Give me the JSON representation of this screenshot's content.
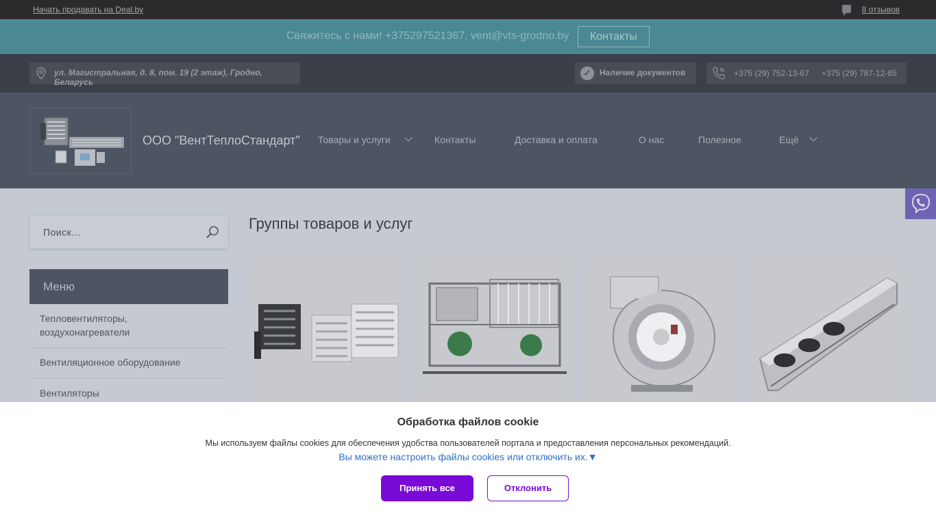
{
  "topbar": {
    "sell_link": "Начать продавать на Deal.by",
    "reviews_link": "8 отзывов"
  },
  "contact_bar": {
    "text": "Свяжитесь с нами! +375297521367, vent@vts-grodno.by",
    "button": "Контакты"
  },
  "info_bar": {
    "address": "ул. Магистральная, д. 8, пом. 19 (2 этаж), Гродно, Беларусь",
    "documents": "Наличие документов",
    "phone_1": "+375 (29) 752-13-67",
    "phone_2": "+375 (29) 787-12-85"
  },
  "header": {
    "company_name": "ООО \"ВентТеплоСтандарт\"",
    "nav": {
      "products": "Товары и услуги",
      "contacts": "Контакты",
      "delivery": "Доставка и оплата",
      "about": "О нас",
      "useful": "Полезное",
      "more": "Ещё"
    }
  },
  "sidebar": {
    "search_placeholder": "Поиск...",
    "menu_title": "Меню",
    "items": [
      {
        "line1": "Тепловентиляторы,",
        "line2": "воздухонагреватели"
      },
      {
        "line1": "Вентиляционное оборудование"
      },
      {
        "line1": "Вентиляторы"
      }
    ]
  },
  "main": {
    "title": "Группы товаров и услуг"
  },
  "cookie_banner": {
    "title": "Обработка файлов cookie",
    "description": "Мы используем файлы cookies для обеспечения удобства пользователей портала и предоставления персональных рекомендаций.",
    "settings_link": "Вы можете настроить файлы cookies или отключить их.▼",
    "accept": "Принять все",
    "decline": "Отклонить"
  },
  "colors": {
    "accent": "#7a0ad6",
    "link": "#2a71c9",
    "contact_bar": "#4a8893",
    "viber": "#6e63b3"
  }
}
